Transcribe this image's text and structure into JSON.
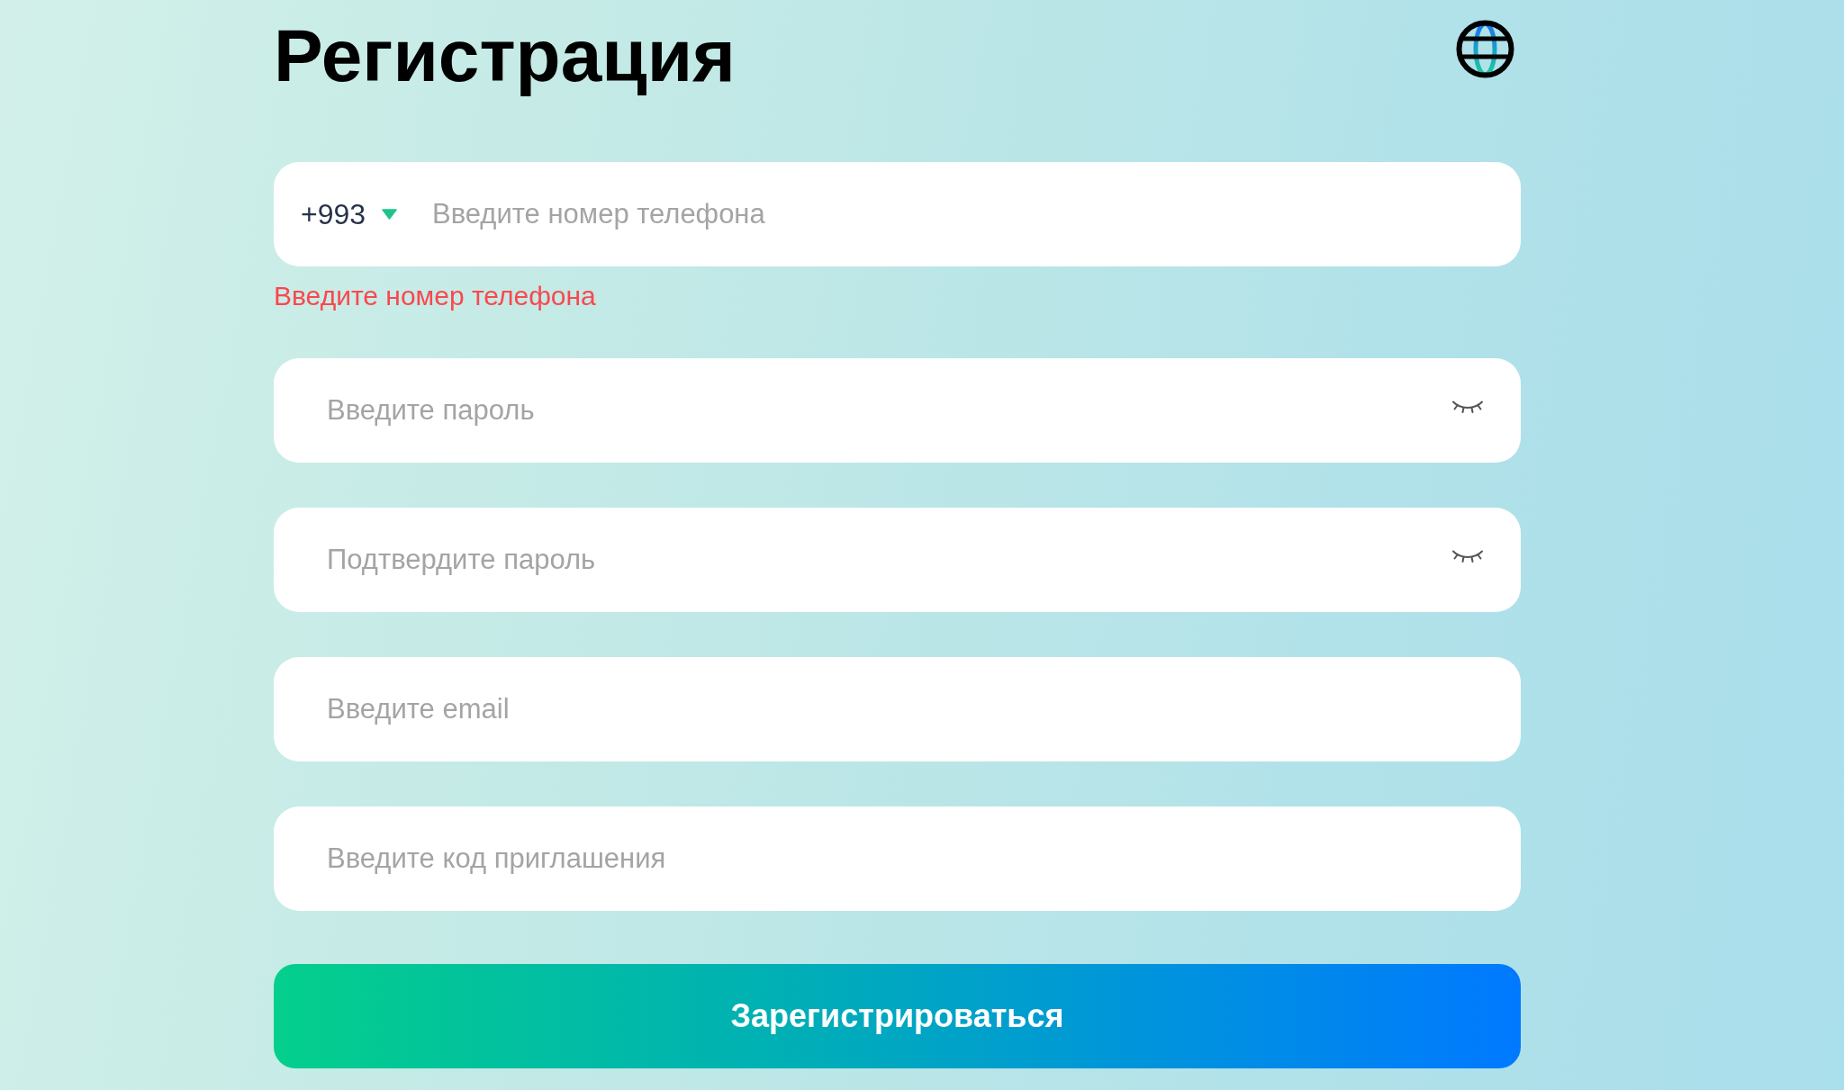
{
  "title": "Регистрация",
  "fields": [
    {
      "kind": "phone",
      "country_code": "+993",
      "placeholder": "Введите номер телефона",
      "error": "Введите номер телефона"
    },
    {
      "kind": "password",
      "placeholder": "Введите пароль",
      "visible": false
    },
    {
      "kind": "password",
      "placeholder": "Подтвердите пароль",
      "visible": false
    },
    {
      "kind": "email",
      "placeholder": "Введите email"
    },
    {
      "kind": "code",
      "placeholder": "Введите код приглашения"
    }
  ],
  "submit_button": "Зарегистрироваться"
}
